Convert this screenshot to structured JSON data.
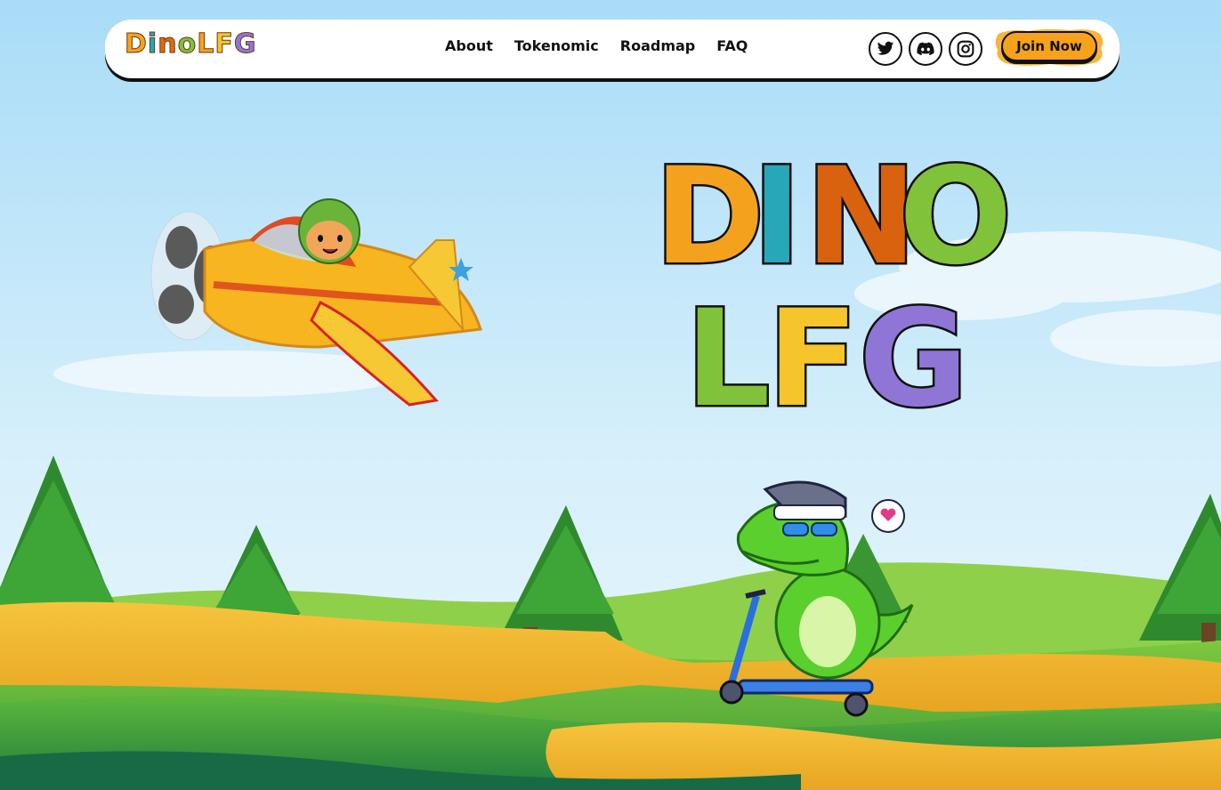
{
  "brand": {
    "logo_letters": [
      {
        "char": "D",
        "color": "#f4a21e"
      },
      {
        "char": "i",
        "color": "#27a7b8"
      },
      {
        "char": "n",
        "color": "#e06a12"
      },
      {
        "char": "o",
        "color": "#7cc23a"
      },
      {
        "char": "L",
        "color": "#f4a21e"
      },
      {
        "char": "F",
        "color": "#f5c52b"
      },
      {
        "char": "G",
        "color": "#8f76d6"
      }
    ]
  },
  "nav": {
    "about": "About",
    "tokenomic": "Tokenomic",
    "roadmap": "Roadmap",
    "faq": "FAQ"
  },
  "social": {
    "twitter_icon": "twitter-icon",
    "discord_icon": "discord-icon",
    "instagram_icon": "instagram-icon"
  },
  "cta": {
    "join_label": "Join Now",
    "accent": "#f7a21b"
  },
  "hero": {
    "line1": [
      {
        "char": "D",
        "color": "#f4a21e"
      },
      {
        "char": "I",
        "color": "#27a7b8"
      },
      {
        "char": "N",
        "color": "#d9620f"
      },
      {
        "char": "O",
        "color": "#80c23a"
      }
    ],
    "line2": [
      {
        "char": "L",
        "color": "#80c23a"
      },
      {
        "char": "F",
        "color": "#f5c52b"
      },
      {
        "char": "G",
        "color": "#8f76d6"
      }
    ]
  },
  "illustrations": {
    "plane": "dog-pilot-airplane",
    "dino": "dino-on-scooter",
    "speech": "heart-icon"
  }
}
